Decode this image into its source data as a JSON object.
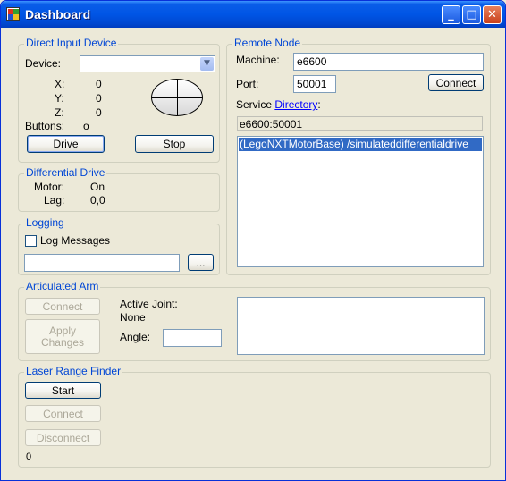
{
  "window": {
    "title": "Dashboard",
    "controls": {
      "minimize": "_",
      "maximize": "□",
      "close": "✕"
    }
  },
  "direct_input": {
    "title": "Direct Input Device",
    "device_label": "Device:",
    "device_value": "",
    "x_label": "X:",
    "x_value": "0",
    "y_label": "Y:",
    "y_value": "0",
    "z_label": "Z:",
    "z_value": "0",
    "buttons_label": "Buttons:",
    "buttons_value": "o",
    "drive_button": "Drive",
    "stop_button": "Stop"
  },
  "differential_drive": {
    "title": "Differential Drive",
    "motor_label": "Motor:",
    "motor_value": "On",
    "lag_label": "Lag:",
    "lag_value": "0,0"
  },
  "logging": {
    "title": "Logging",
    "log_messages_label": "Log Messages",
    "log_messages_checked": false,
    "path_value": "",
    "browse_button": "..."
  },
  "remote_node": {
    "title": "Remote Node",
    "machine_label": "Machine:",
    "machine_value": "e6600",
    "port_label": "Port:",
    "port_value": "50001",
    "connect_button": "Connect",
    "service_label": "Service ",
    "directory_link": "Directory",
    "service_suffix": ":",
    "service_address": "e6600:50001",
    "services": [
      "(LegoNXTMotorBase) /simulateddifferentialdrive"
    ]
  },
  "articulated_arm": {
    "title": "Articulated Arm",
    "connect_button": "Connect",
    "apply_line1": "Apply",
    "apply_line2": "Changes",
    "active_joint_label": "Active Joint:",
    "active_joint_value": "None",
    "angle_label": "Angle:",
    "angle_value": ""
  },
  "laser_range_finder": {
    "title": "Laser Range Finder",
    "start_button": "Start",
    "connect_button": "Connect",
    "disconnect_button": "Disconnect",
    "status_value": "0"
  }
}
